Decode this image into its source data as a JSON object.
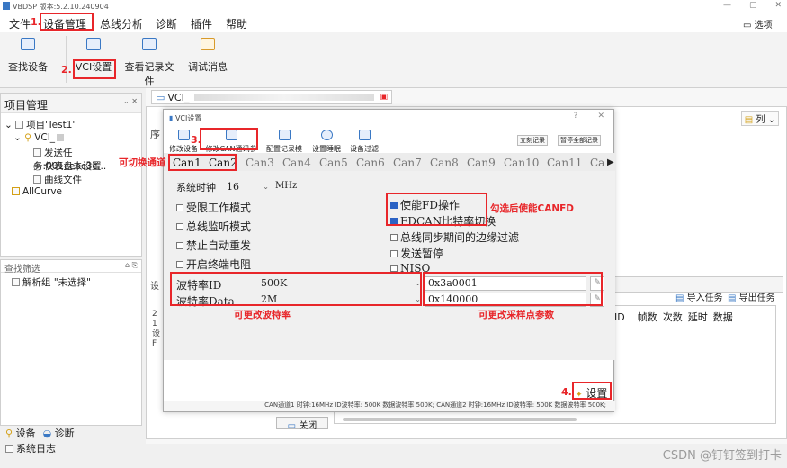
{
  "app": {
    "title": "VBDSP 版本:5.2.10.240904",
    "window_controls": [
      "—",
      "▢",
      "✕"
    ]
  },
  "menu": {
    "items": [
      "文件",
      "设备管理",
      "总线分析",
      "诊断",
      "插件",
      "帮助"
    ],
    "right": "选项"
  },
  "ribbon": {
    "buttons": [
      "查找设备",
      "VCI设置",
      "查看记录文件",
      "调试消息"
    ]
  },
  "project_panel": {
    "title": "项目管理",
    "project": "项目'Test1'",
    "device": "VCI_",
    "task": "发送任务:001cebc3c...",
    "meter": "仪表盘未设置",
    "curve_file": "曲线文件",
    "all_curve": "AllCurve"
  },
  "filter_panel": {
    "title": "查找筛选",
    "item": "解析组 \"未选择\""
  },
  "bottom_tabs": [
    "设备",
    "诊断"
  ],
  "syslog": "系统日志",
  "doc_tab": "VCI_",
  "bg_window": {
    "col_label": "列",
    "import": "导入任务",
    "export": "导出任务",
    "columns": [
      "ID",
      "帧数",
      "次数",
      "延时",
      "数据"
    ],
    "close": "关闭"
  },
  "dialog": {
    "title": "VCI设置",
    "help": "?",
    "close": "✕",
    "toolbar": [
      "修改设备",
      "修改CAN通讯参数",
      "配置记录模式",
      "设置睡眠",
      "设备过滤"
    ],
    "record_now": "立刻记录",
    "pause_record": "暂停全部记录",
    "can_tabs": [
      "Can1",
      "Can2",
      "Can3",
      "Can4",
      "Can5",
      "Can6",
      "Can7",
      "Can8",
      "Can9",
      "Can10",
      "Can11",
      "Ca"
    ],
    "clock_label": "系统时钟",
    "clock_value": "16",
    "clock_unit": "MHz",
    "left_options": [
      "受限工作模式",
      "总线监听模式",
      "禁止自动重发",
      "开启终端电阻"
    ],
    "right_options": [
      {
        "label": "使能FD操作",
        "checked": true
      },
      {
        "label": "FDCAN比特率切换",
        "checked": true
      },
      {
        "label": "总线同步期间的边缘过滤",
        "checked": false
      },
      {
        "label": "发送暂停",
        "checked": false
      },
      {
        "label": "NISO",
        "checked": false
      }
    ],
    "baud_id_label": "波特率ID",
    "baud_id_value": "500K",
    "baud_data_label": "波特率Data",
    "baud_data_value": "2M",
    "sample_id_value": "0x3a0001",
    "sample_data_value": "0x140000",
    "set_button": "设置",
    "status": "CAN通道1 时钟:16MHz ID波特率: 500K 数据波特率 500K; CAN通道2 时钟:16MHz ID波特率: 500K 数据波特率 500K;"
  },
  "annotations": {
    "n1": "1.",
    "n2": "2.",
    "n3": "3.",
    "n4": "4.",
    "switch_channel": "可切换通道",
    "enable_fd": "勾选后使能CANFD",
    "change_baud": "可更改波特率",
    "change_sample": "可更改采样点参数"
  },
  "watermark": "CSDN @钉钉签到打卡",
  "colors": {
    "annotation_red": "#e8262a",
    "accent_blue": "#2b62c4"
  }
}
